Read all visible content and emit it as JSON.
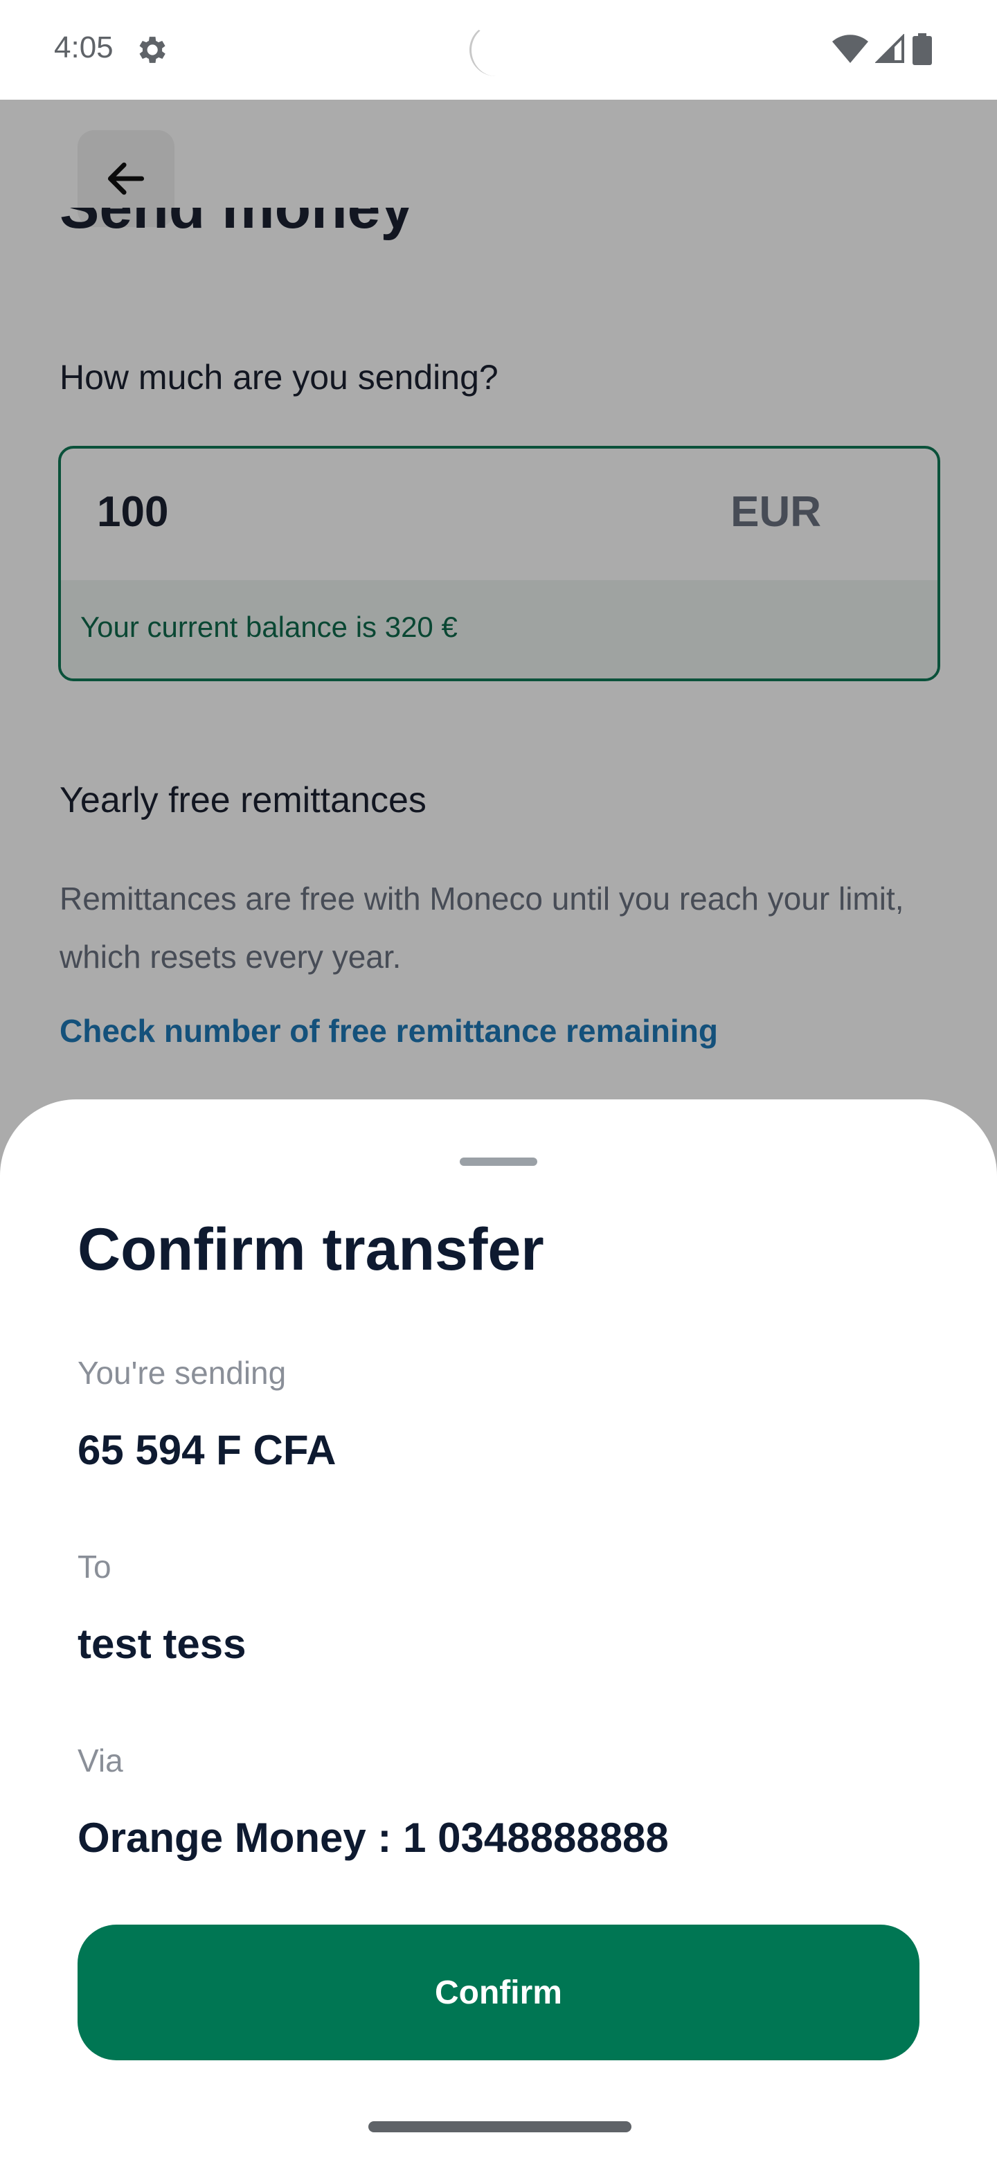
{
  "status_bar": {
    "time": "4:05",
    "icons": [
      "settings-gear-icon",
      "wifi-icon",
      "cell-signal-icon",
      "battery-icon"
    ]
  },
  "page": {
    "title": "Send money",
    "amount_label": "How much are you sending?",
    "amount_value": "100",
    "currency": "EUR",
    "balance_text": "Your current balance is 320 €",
    "yearly_title": "Yearly free remittances",
    "yearly_desc": "Remittances are free with Moneco until you reach your limit, which resets every year.",
    "check_link": "Check number of free remittance remaining"
  },
  "sheet": {
    "title": "Confirm transfer",
    "sending_label": "You're sending",
    "sending_value": "65 594 F CFA",
    "to_label": "To",
    "to_value": "test tess",
    "via_label": "Via",
    "via_value": "Orange Money : 1 0348888888",
    "confirm_label": "Confirm"
  },
  "colors": {
    "primary_green": "#007653",
    "link_blue": "#1f7ab8",
    "text_dark": "#0e1a30",
    "overlay": "rgba(0,0,0,0.33)"
  }
}
